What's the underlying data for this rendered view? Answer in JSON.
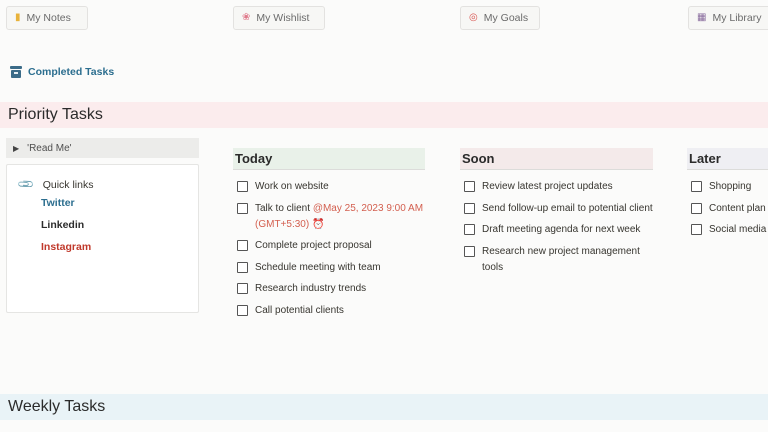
{
  "nav": [
    {
      "label": "My Notes",
      "icon": "notepad-icon",
      "color": "#f2c14e"
    },
    {
      "label": "My Wishlist",
      "icon": "ribbon-icon",
      "color": "#e07a8b"
    },
    {
      "label": "My Goals",
      "icon": "target-icon",
      "color": "#d9534f"
    },
    {
      "label": "My Library",
      "icon": "books-icon",
      "color": "#8a6d9e"
    }
  ],
  "completed_link": "Completed Tasks",
  "priority_title": "Priority Tasks",
  "weekly_title": "Weekly Tasks",
  "readme": "'Read Me'",
  "quick_links": {
    "title": "Quick links",
    "twitter": "Twitter",
    "linkedin": "Linkedin",
    "instagram": "Instagram"
  },
  "columns": {
    "today": {
      "title": "Today",
      "tasks": [
        "Work on website",
        "Talk to client",
        "Complete project proposal",
        "Schedule meeting with team",
        "Research industry trends",
        "Call potential clients"
      ],
      "reminder": "@May 25, 2023 9:00 AM (GMT+5:30)"
    },
    "soon": {
      "title": "Soon",
      "tasks": [
        "Review latest project updates",
        "Send follow-up email to potential client",
        "Draft meeting agenda for next week",
        "Research new project management tools"
      ]
    },
    "later": {
      "title": "Later",
      "tasks": [
        "Shopping",
        "Content plan",
        "Social media"
      ]
    }
  },
  "colors": {
    "priority_bg": "#fbeced",
    "weekly_bg": "#e9f3f7",
    "link_blue": "#2c6e8f",
    "link_red": "#c0392b"
  }
}
